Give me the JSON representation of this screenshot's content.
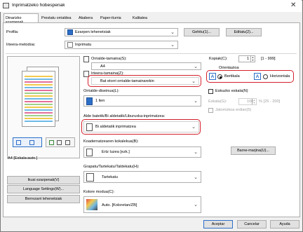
{
  "window": {
    "title": "Inprimatzeko hobespenak",
    "close_glyph": "✕"
  },
  "tabs": [
    {
      "label": "Dinarizko ezarpenak"
    },
    {
      "label": "Prestatu orrialdea"
    },
    {
      "label": "Akabera"
    },
    {
      "label": "Paper-iturria"
    },
    {
      "label": "Kalitatea"
    }
  ],
  "profile": {
    "label": "Profila:",
    "value": "Ezarpen lehenetsiak",
    "add_button": "Gehitu(1)...",
    "edit_button": "Editatu(2)..."
  },
  "output_method": {
    "label": "Irteera-metodoa:",
    "value": "Inprimatu"
  },
  "preview": {
    "caption": "A4 [Eskala:auto.]"
  },
  "left_buttons": {
    "view_settings": "Ikusi ezarpenak(V)",
    "language": "Language Settings(W)...",
    "restore": "Berrezarri lehenetsiak"
  },
  "page_size": {
    "label": "Orrialde-tamaina(S):",
    "value": "A4"
  },
  "output_size": {
    "label": "Irteera-tamaina(Z):",
    "value": "Bat etorri orrialde-tamainarekin"
  },
  "copies": {
    "label": "Kopiak(C):",
    "value": "1",
    "range": "[1 - 999]"
  },
  "orientation": {
    "label": "Orientazioa",
    "portrait": "Bertikala",
    "landscape": "Horizontala",
    "icon_letter": "A"
  },
  "page_layout": {
    "label": "Orrialde-diseinua(L):",
    "value": "1 lien"
  },
  "manual_scaling": {
    "label": "Eskuzko eskala(N)",
    "scaling_label": "Eskala(G):",
    "scaling_value": "100",
    "scaling_range": "% [25 - 200]",
    "watermark": "Jatorrizkoa erdian(5)"
  },
  "duplex": {
    "label": "Alde batetik/Bi aldetatik/Liburuxka-inprimatzea:",
    "value": "Bi aldetatik inprimatzea"
  },
  "binding": {
    "label": "Koadernatzearen kokalekua(B):",
    "value": "Ertz luzea [ezk.]",
    "margin_button": "Barne-marjina(U)..."
  },
  "staple": {
    "label": "Grapatu/Tartekatu/Taldekatu(H):",
    "value": "Tartekatu"
  },
  "color_mode": {
    "label": "Kolore modua(C):",
    "value": "Auto. [Koloretan/ZB]"
  },
  "footer": {
    "ok": "Aceptar",
    "cancel": "Cancelar",
    "help": "Ayuda"
  },
  "colors": {
    "accent": "#2c6fc8",
    "highlight": "#d4202a"
  }
}
